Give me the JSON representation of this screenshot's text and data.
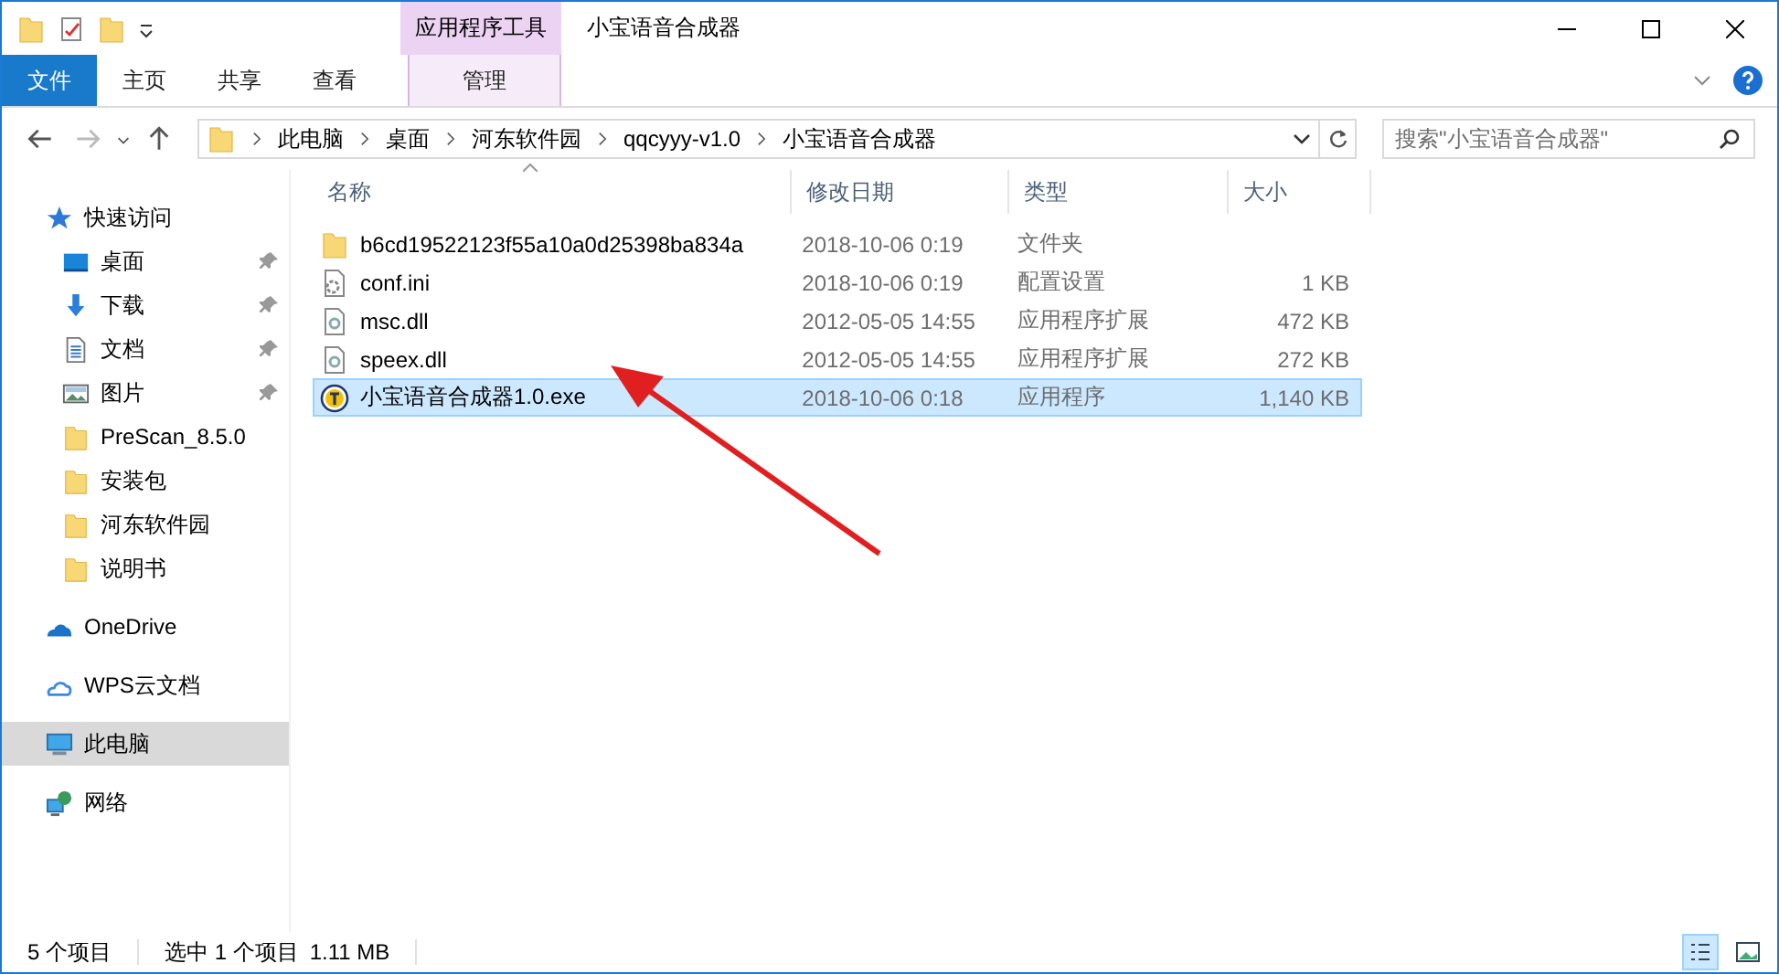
{
  "window": {
    "title": "小宝语音合成器",
    "context_tab": "应用程序工具"
  },
  "ribbon_tabs": [
    {
      "label": "文件",
      "kind": "file",
      "selected": false
    },
    {
      "label": "主页",
      "kind": "normal",
      "selected": false
    },
    {
      "label": "共享",
      "kind": "normal",
      "selected": false
    },
    {
      "label": "查看",
      "kind": "normal",
      "selected": false
    },
    {
      "label": "管理",
      "kind": "context",
      "selected": true
    }
  ],
  "address": {
    "crumbs": [
      "此电脑",
      "桌面",
      "河东软件园",
      "qqcyyy-v1.0",
      "小宝语音合成器"
    ]
  },
  "search": {
    "placeholder": "搜索\"小宝语音合成器\""
  },
  "sidebar": {
    "items": [
      {
        "label": "快速访问",
        "kind": "star",
        "selected": false,
        "children": [
          {
            "label": "桌面",
            "kind": "desktop",
            "pinned": true,
            "selected": false
          },
          {
            "label": "下载",
            "kind": "download",
            "pinned": true,
            "selected": false
          },
          {
            "label": "文档",
            "kind": "document",
            "pinned": true,
            "selected": false
          },
          {
            "label": "图片",
            "kind": "pictures",
            "pinned": true,
            "selected": false
          },
          {
            "label": "PreScan_8.5.0",
            "kind": "folder",
            "pinned": false,
            "selected": false
          },
          {
            "label": "安装包",
            "kind": "folder",
            "pinned": false,
            "selected": false
          },
          {
            "label": "河东软件园",
            "kind": "folder",
            "pinned": false,
            "selected": false
          },
          {
            "label": "说明书",
            "kind": "folder",
            "pinned": false,
            "selected": false
          }
        ]
      },
      {
        "label": "OneDrive",
        "kind": "cloud",
        "selected": false
      },
      {
        "label": "WPS云文档",
        "kind": "cloud-outline",
        "selected": false
      },
      {
        "label": "此电脑",
        "kind": "pc",
        "selected": true
      },
      {
        "label": "网络",
        "kind": "network",
        "selected": false
      }
    ]
  },
  "table": {
    "columns": [
      "名称",
      "修改日期",
      "类型",
      "大小"
    ],
    "rows": [
      {
        "name": "b6cd19522123f55a10a0d25398ba834a",
        "modified": "2018-10-06 0:19",
        "type": "文件夹",
        "size": "",
        "kind": "folder",
        "selected": false
      },
      {
        "name": "conf.ini",
        "modified": "2018-10-06 0:19",
        "type": "配置设置",
        "size": "1 KB",
        "kind": "settings",
        "selected": false
      },
      {
        "name": "msc.dll",
        "modified": "2012-05-05 14:55",
        "type": "应用程序扩展",
        "size": "472 KB",
        "kind": "dll",
        "selected": false
      },
      {
        "name": "speex.dll",
        "modified": "2012-05-05 14:55",
        "type": "应用程序扩展",
        "size": "272 KB",
        "kind": "dll",
        "selected": false
      },
      {
        "name": "小宝语音合成器1.0.exe",
        "modified": "2018-10-06 0:18",
        "type": "应用程序",
        "size": "1,140 KB",
        "kind": "exe",
        "selected": true
      }
    ]
  },
  "status_bar": {
    "count": "5 个项目",
    "selection": "选中 1 个项目",
    "size": "1.11 MB"
  }
}
